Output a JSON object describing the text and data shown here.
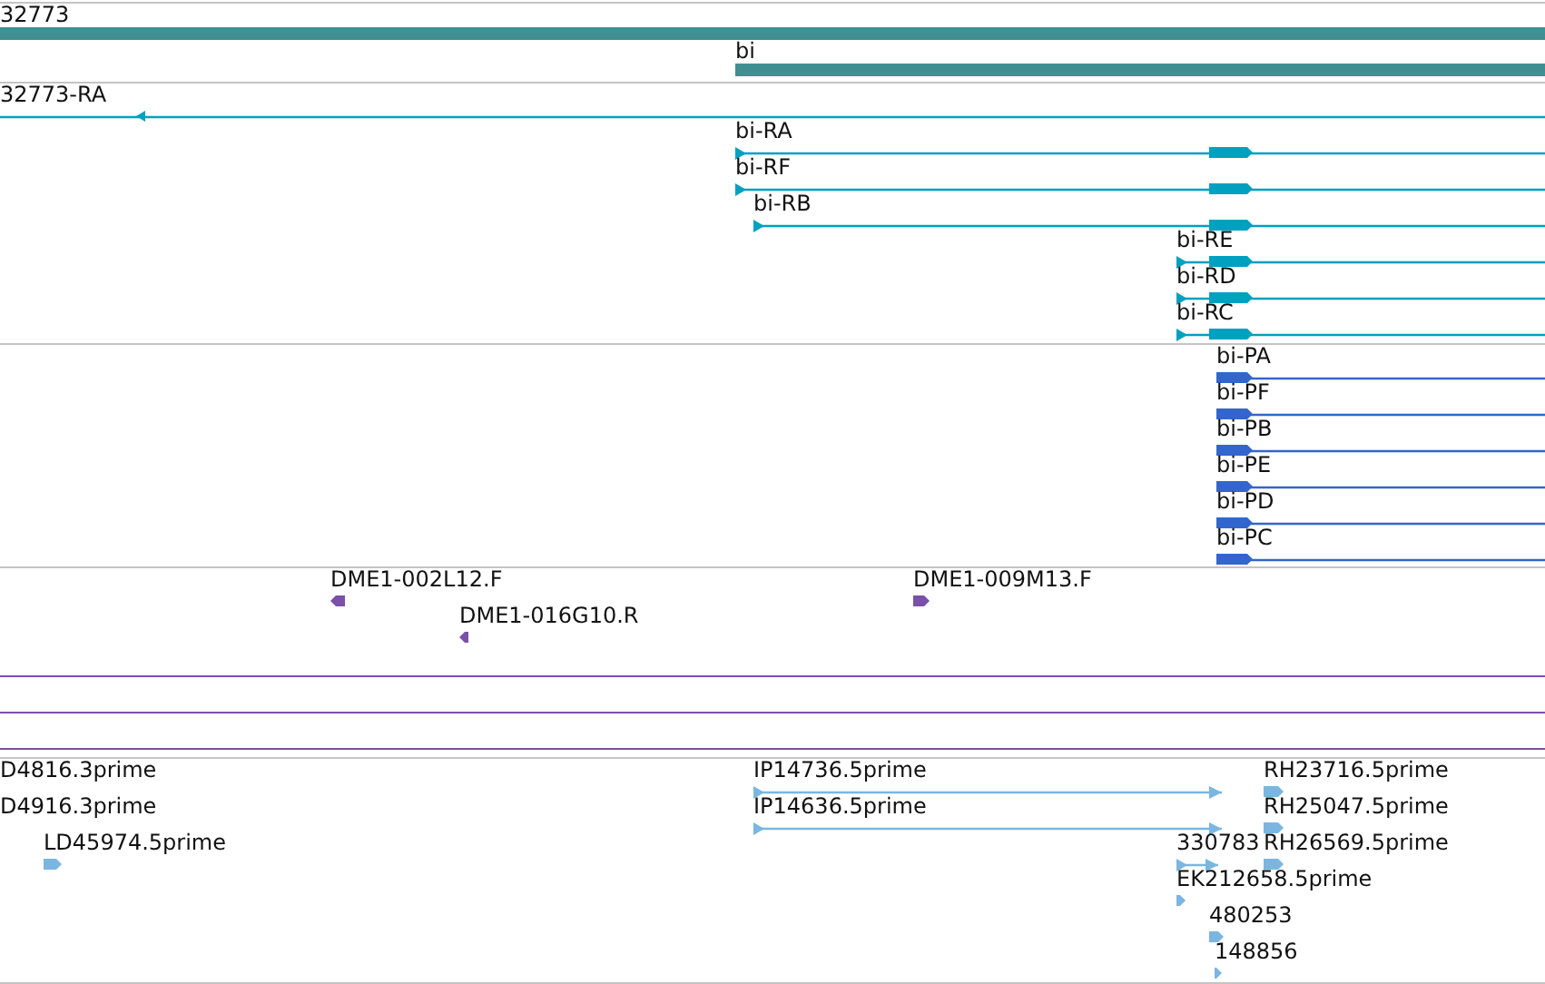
{
  "tracks": [
    {
      "kind": "gene",
      "features": [
        {
          "label": "32773"
        },
        {
          "label": "bi"
        }
      ]
    },
    {
      "kind": "transcript",
      "features": [
        {
          "label": "32773-RA",
          "reverse": true
        },
        {
          "label": "bi-RA",
          "reverse": false
        },
        {
          "label": "bi-RF",
          "reverse": false
        },
        {
          "label": "bi-RB",
          "reverse": false
        },
        {
          "label": "bi-RE",
          "reverse": false
        },
        {
          "label": "bi-RD",
          "reverse": false
        },
        {
          "label": "bi-RC",
          "reverse": false
        }
      ]
    },
    {
      "kind": "protein",
      "features": [
        {
          "label": "bi-PA",
          "reverse": false
        },
        {
          "label": "bi-PF",
          "reverse": false
        },
        {
          "label": "bi-PB",
          "reverse": false
        },
        {
          "label": "bi-PE",
          "reverse": false
        },
        {
          "label": "bi-PD",
          "reverse": false
        },
        {
          "label": "bi-PC",
          "reverse": false
        }
      ]
    },
    {
      "kind": "primer",
      "features": [
        {
          "label": "DME1-002L12.F",
          "reverse": true
        },
        {
          "label": "DME1-016G10.R",
          "reverse": true
        },
        {
          "label": "DME1-009M13.F",
          "reverse": false
        }
      ]
    },
    {
      "kind": "est",
      "features": [
        {
          "label": "D4816.3prime"
        },
        {
          "label": "D4916.3prime"
        },
        {
          "label": "LD45974.5prime",
          "reverse": false
        },
        {
          "label": "IP14736.5prime",
          "reverse": false
        },
        {
          "label": "IP14636.5prime",
          "reverse": false
        },
        {
          "label": "RH23716.5prime",
          "reverse": false
        },
        {
          "label": "RH25047.5prime",
          "reverse": false
        },
        {
          "label": "330783",
          "reverse": false
        },
        {
          "label": "RH26569.5prime",
          "reverse": false
        },
        {
          "label": "EK212658.5prime",
          "reverse": false
        },
        {
          "label": "480253",
          "reverse": false
        },
        {
          "label": "148856",
          "reverse": false
        }
      ]
    }
  ]
}
